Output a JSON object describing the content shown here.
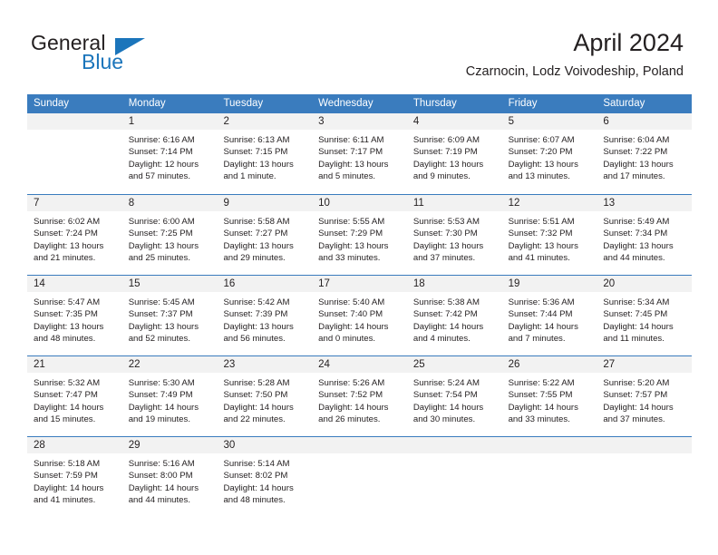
{
  "brand": {
    "name_part1": "General",
    "name_part2": "Blue",
    "accent_color": "#1b75bb"
  },
  "header": {
    "month_title": "April 2024",
    "location": "Czarnocin, Lodz Voivodeship, Poland"
  },
  "calendar": {
    "header_color": "#3a7cbe",
    "daynum_band_color": "#f2f2f2",
    "day_names": [
      "Sunday",
      "Monday",
      "Tuesday",
      "Wednesday",
      "Thursday",
      "Friday",
      "Saturday"
    ],
    "weeks": [
      [
        {
          "day": "",
          "empty": true
        },
        {
          "day": "1",
          "sunrise": "Sunrise: 6:16 AM",
          "sunset": "Sunset: 7:14 PM",
          "daylight_line1": "Daylight: 12 hours",
          "daylight_line2": "and 57 minutes."
        },
        {
          "day": "2",
          "sunrise": "Sunrise: 6:13 AM",
          "sunset": "Sunset: 7:15 PM",
          "daylight_line1": "Daylight: 13 hours",
          "daylight_line2": "and 1 minute."
        },
        {
          "day": "3",
          "sunrise": "Sunrise: 6:11 AM",
          "sunset": "Sunset: 7:17 PM",
          "daylight_line1": "Daylight: 13 hours",
          "daylight_line2": "and 5 minutes."
        },
        {
          "day": "4",
          "sunrise": "Sunrise: 6:09 AM",
          "sunset": "Sunset: 7:19 PM",
          "daylight_line1": "Daylight: 13 hours",
          "daylight_line2": "and 9 minutes."
        },
        {
          "day": "5",
          "sunrise": "Sunrise: 6:07 AM",
          "sunset": "Sunset: 7:20 PM",
          "daylight_line1": "Daylight: 13 hours",
          "daylight_line2": "and 13 minutes."
        },
        {
          "day": "6",
          "sunrise": "Sunrise: 6:04 AM",
          "sunset": "Sunset: 7:22 PM",
          "daylight_line1": "Daylight: 13 hours",
          "daylight_line2": "and 17 minutes."
        }
      ],
      [
        {
          "day": "7",
          "sunrise": "Sunrise: 6:02 AM",
          "sunset": "Sunset: 7:24 PM",
          "daylight_line1": "Daylight: 13 hours",
          "daylight_line2": "and 21 minutes."
        },
        {
          "day": "8",
          "sunrise": "Sunrise: 6:00 AM",
          "sunset": "Sunset: 7:25 PM",
          "daylight_line1": "Daylight: 13 hours",
          "daylight_line2": "and 25 minutes."
        },
        {
          "day": "9",
          "sunrise": "Sunrise: 5:58 AM",
          "sunset": "Sunset: 7:27 PM",
          "daylight_line1": "Daylight: 13 hours",
          "daylight_line2": "and 29 minutes."
        },
        {
          "day": "10",
          "sunrise": "Sunrise: 5:55 AM",
          "sunset": "Sunset: 7:29 PM",
          "daylight_line1": "Daylight: 13 hours",
          "daylight_line2": "and 33 minutes."
        },
        {
          "day": "11",
          "sunrise": "Sunrise: 5:53 AM",
          "sunset": "Sunset: 7:30 PM",
          "daylight_line1": "Daylight: 13 hours",
          "daylight_line2": "and 37 minutes."
        },
        {
          "day": "12",
          "sunrise": "Sunrise: 5:51 AM",
          "sunset": "Sunset: 7:32 PM",
          "daylight_line1": "Daylight: 13 hours",
          "daylight_line2": "and 41 minutes."
        },
        {
          "day": "13",
          "sunrise": "Sunrise: 5:49 AM",
          "sunset": "Sunset: 7:34 PM",
          "daylight_line1": "Daylight: 13 hours",
          "daylight_line2": "and 44 minutes."
        }
      ],
      [
        {
          "day": "14",
          "sunrise": "Sunrise: 5:47 AM",
          "sunset": "Sunset: 7:35 PM",
          "daylight_line1": "Daylight: 13 hours",
          "daylight_line2": "and 48 minutes."
        },
        {
          "day": "15",
          "sunrise": "Sunrise: 5:45 AM",
          "sunset": "Sunset: 7:37 PM",
          "daylight_line1": "Daylight: 13 hours",
          "daylight_line2": "and 52 minutes."
        },
        {
          "day": "16",
          "sunrise": "Sunrise: 5:42 AM",
          "sunset": "Sunset: 7:39 PM",
          "daylight_line1": "Daylight: 13 hours",
          "daylight_line2": "and 56 minutes."
        },
        {
          "day": "17",
          "sunrise": "Sunrise: 5:40 AM",
          "sunset": "Sunset: 7:40 PM",
          "daylight_line1": "Daylight: 14 hours",
          "daylight_line2": "and 0 minutes."
        },
        {
          "day": "18",
          "sunrise": "Sunrise: 5:38 AM",
          "sunset": "Sunset: 7:42 PM",
          "daylight_line1": "Daylight: 14 hours",
          "daylight_line2": "and 4 minutes."
        },
        {
          "day": "19",
          "sunrise": "Sunrise: 5:36 AM",
          "sunset": "Sunset: 7:44 PM",
          "daylight_line1": "Daylight: 14 hours",
          "daylight_line2": "and 7 minutes."
        },
        {
          "day": "20",
          "sunrise": "Sunrise: 5:34 AM",
          "sunset": "Sunset: 7:45 PM",
          "daylight_line1": "Daylight: 14 hours",
          "daylight_line2": "and 11 minutes."
        }
      ],
      [
        {
          "day": "21",
          "sunrise": "Sunrise: 5:32 AM",
          "sunset": "Sunset: 7:47 PM",
          "daylight_line1": "Daylight: 14 hours",
          "daylight_line2": "and 15 minutes."
        },
        {
          "day": "22",
          "sunrise": "Sunrise: 5:30 AM",
          "sunset": "Sunset: 7:49 PM",
          "daylight_line1": "Daylight: 14 hours",
          "daylight_line2": "and 19 minutes."
        },
        {
          "day": "23",
          "sunrise": "Sunrise: 5:28 AM",
          "sunset": "Sunset: 7:50 PM",
          "daylight_line1": "Daylight: 14 hours",
          "daylight_line2": "and 22 minutes."
        },
        {
          "day": "24",
          "sunrise": "Sunrise: 5:26 AM",
          "sunset": "Sunset: 7:52 PM",
          "daylight_line1": "Daylight: 14 hours",
          "daylight_line2": "and 26 minutes."
        },
        {
          "day": "25",
          "sunrise": "Sunrise: 5:24 AM",
          "sunset": "Sunset: 7:54 PM",
          "daylight_line1": "Daylight: 14 hours",
          "daylight_line2": "and 30 minutes."
        },
        {
          "day": "26",
          "sunrise": "Sunrise: 5:22 AM",
          "sunset": "Sunset: 7:55 PM",
          "daylight_line1": "Daylight: 14 hours",
          "daylight_line2": "and 33 minutes."
        },
        {
          "day": "27",
          "sunrise": "Sunrise: 5:20 AM",
          "sunset": "Sunset: 7:57 PM",
          "daylight_line1": "Daylight: 14 hours",
          "daylight_line2": "and 37 minutes."
        }
      ],
      [
        {
          "day": "28",
          "sunrise": "Sunrise: 5:18 AM",
          "sunset": "Sunset: 7:59 PM",
          "daylight_line1": "Daylight: 14 hours",
          "daylight_line2": "and 41 minutes."
        },
        {
          "day": "29",
          "sunrise": "Sunrise: 5:16 AM",
          "sunset": "Sunset: 8:00 PM",
          "daylight_line1": "Daylight: 14 hours",
          "daylight_line2": "and 44 minutes."
        },
        {
          "day": "30",
          "sunrise": "Sunrise: 5:14 AM",
          "sunset": "Sunset: 8:02 PM",
          "daylight_line1": "Daylight: 14 hours",
          "daylight_line2": "and 48 minutes."
        },
        {
          "day": "",
          "empty": true
        },
        {
          "day": "",
          "empty": true
        },
        {
          "day": "",
          "empty": true
        },
        {
          "day": "",
          "empty": true
        }
      ]
    ]
  }
}
